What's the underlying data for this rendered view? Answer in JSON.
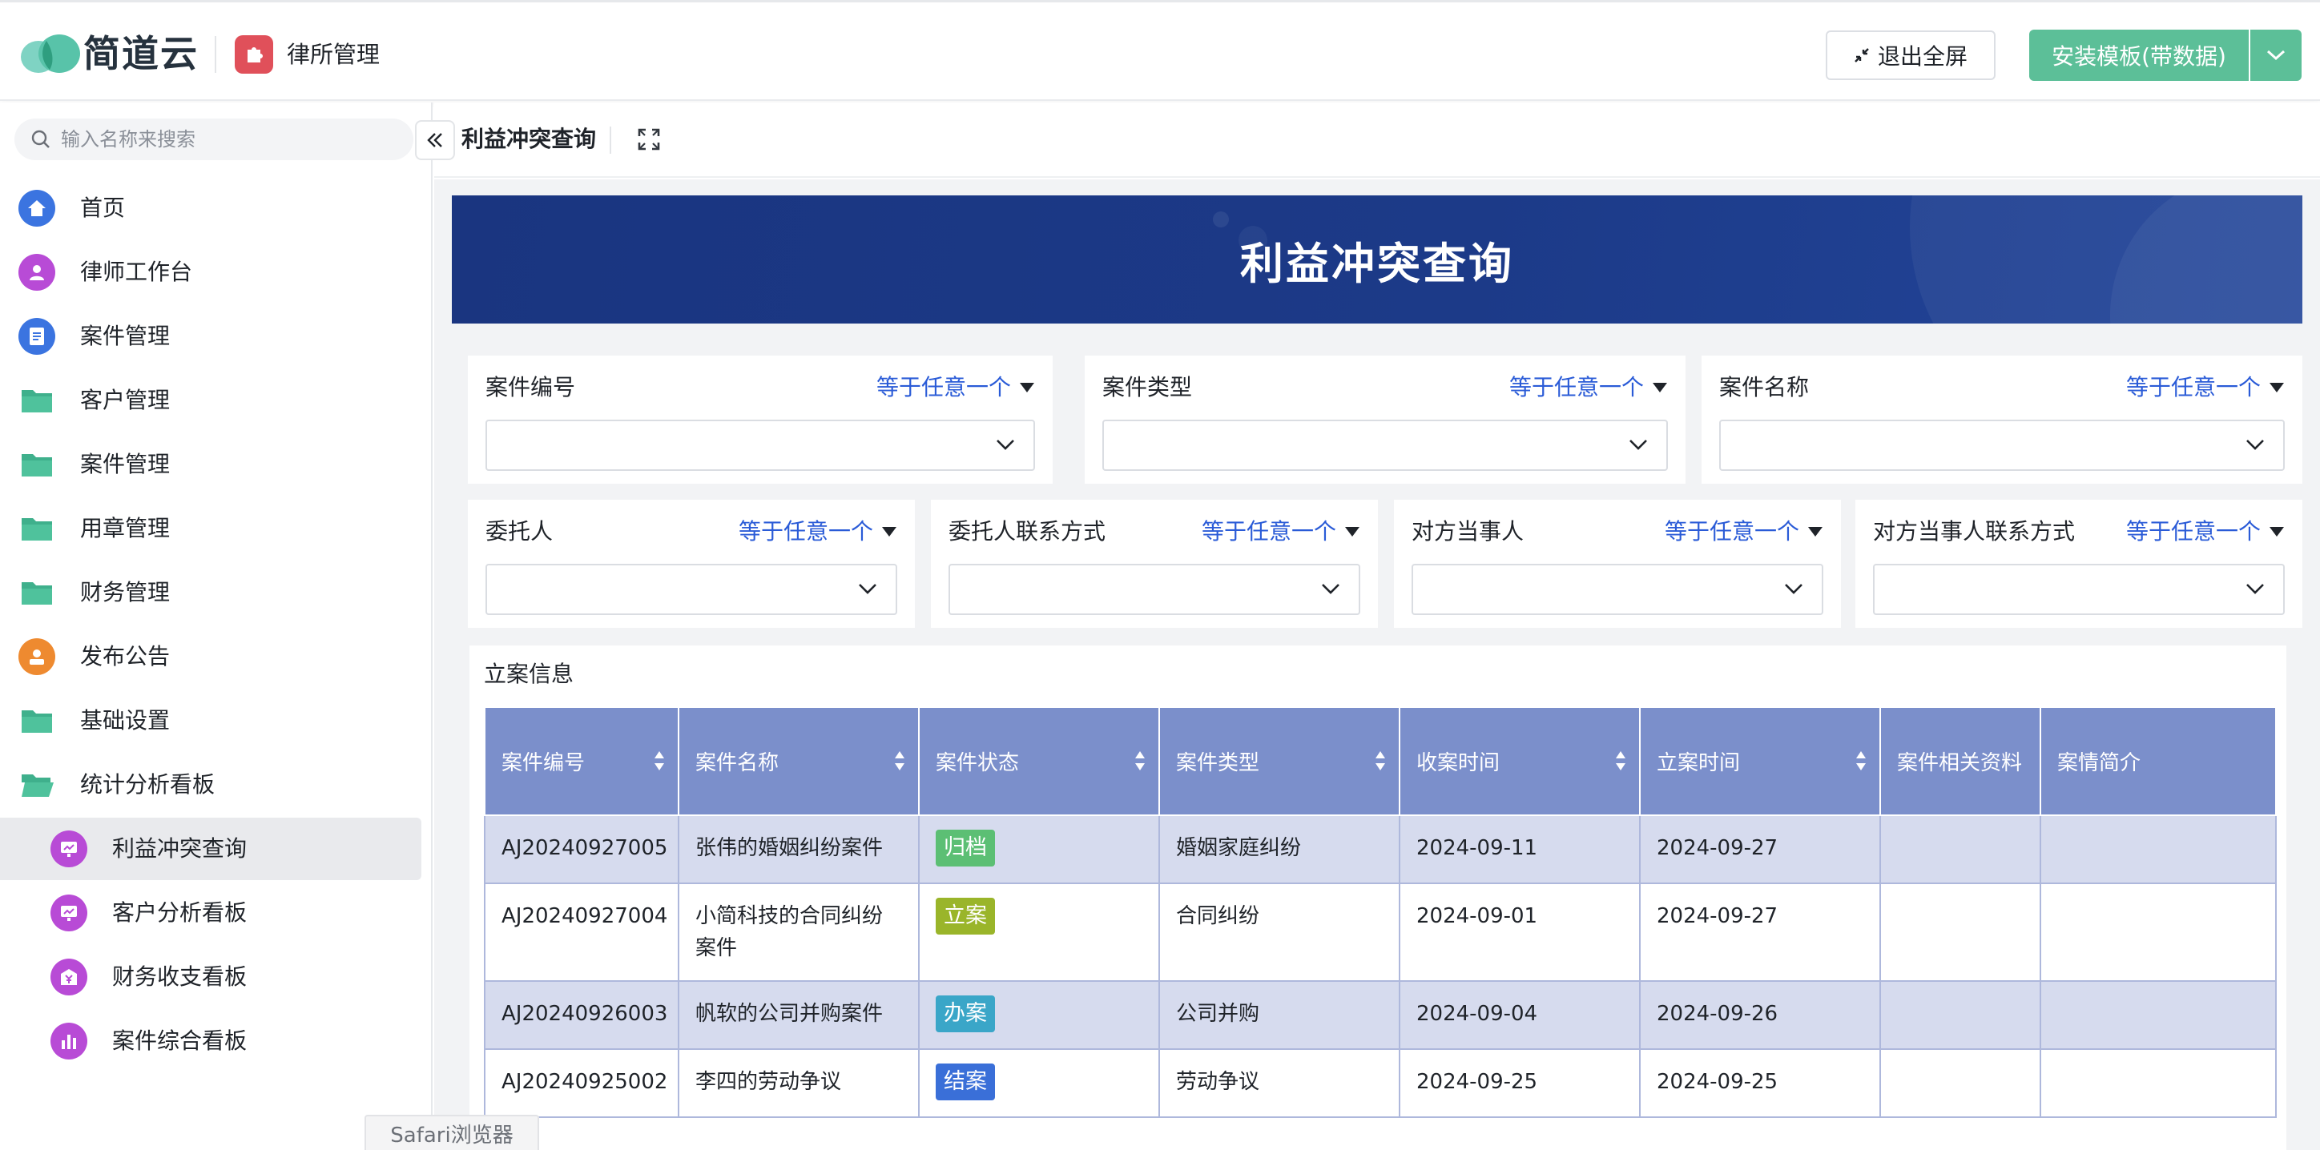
{
  "header": {
    "brand_name": "简道云",
    "app_name": "律所管理",
    "exit_fullscreen": "退出全屏",
    "install_template": "安装模板(带数据)"
  },
  "sidebar": {
    "search_placeholder": "输入名称来搜索",
    "items": [
      {
        "label": "首页",
        "icon": "home-icon"
      },
      {
        "label": "律师工作台",
        "icon": "lawyer-icon"
      },
      {
        "label": "案件管理",
        "icon": "document-icon"
      },
      {
        "label": "客户管理",
        "icon": "folder-icon"
      },
      {
        "label": "案件管理",
        "icon": "folder-icon"
      },
      {
        "label": "用章管理",
        "icon": "folder-icon"
      },
      {
        "label": "财务管理",
        "icon": "folder-icon"
      },
      {
        "label": "发布公告",
        "icon": "announcement-icon"
      },
      {
        "label": "基础设置",
        "icon": "folder-icon"
      },
      {
        "label": "统计分析看板",
        "icon": "folder-open-icon"
      }
    ],
    "sub_items": [
      {
        "label": "利益冲突查询",
        "icon": "dashboard-icon",
        "active": true
      },
      {
        "label": "客户分析看板",
        "icon": "dashboard-icon"
      },
      {
        "label": "财务收支看板",
        "icon": "finance-icon"
      },
      {
        "label": "案件综合看板",
        "icon": "bar-chart-icon"
      }
    ]
  },
  "page": {
    "title": "利益冲突查询",
    "banner_title": "利益冲突查询"
  },
  "filters": [
    {
      "label": "案件编号",
      "op": "等于任意一个"
    },
    {
      "label": "案件类型",
      "op": "等于任意一个"
    },
    {
      "label": "案件名称",
      "op": "等于任意一个"
    },
    {
      "label": "委托人",
      "op": "等于任意一个"
    },
    {
      "label": "委托人联系方式",
      "op": "等于任意一个"
    },
    {
      "label": "对方当事人",
      "op": "等于任意一个"
    },
    {
      "label": "对方当事人联系方式",
      "op": "等于任意一个"
    }
  ],
  "table": {
    "section_label": "立案信息",
    "columns": [
      "案件编号",
      "案件名称",
      "案件状态",
      "案件类型",
      "收案时间",
      "立案时间",
      "案件相关资料",
      "案情简介"
    ],
    "rows": [
      {
        "id": "AJ20240927005",
        "name": "张伟的婚姻纠纷案件",
        "status": "归档",
        "type": "婚姻家庭纠纷",
        "received": "2024-09-11",
        "filed": "2024-09-27",
        "docs": "",
        "summary": ""
      },
      {
        "id": "AJ20240927004",
        "name": "小简科技的合同纠纷案件",
        "status": "立案",
        "type": "合同纠纷",
        "received": "2024-09-01",
        "filed": "2024-09-27",
        "docs": "",
        "summary": ""
      },
      {
        "id": "AJ20240926003",
        "name": "帆软的公司并购案件",
        "status": "办案",
        "type": "公司并购",
        "received": "2024-09-04",
        "filed": "2024-09-26",
        "docs": "",
        "summary": ""
      },
      {
        "id": "AJ20240925002",
        "name": "李四的劳动争议",
        "status": "结案",
        "type": "劳动争议",
        "received": "2024-09-25",
        "filed": "2024-09-25",
        "docs": "",
        "summary": ""
      }
    ]
  },
  "status_colors": {
    "归档": "#5cbf74",
    "立案": "#9ab52a",
    "办案": "#3aa6c8",
    "结案": "#3a6fd8"
  },
  "colors": {
    "brand_green": "#5cbf98",
    "banner_blue": "#1c3a88",
    "table_header": "#7b8fcb",
    "link_blue": "#2a5bd7"
  },
  "tooltip": "Safari浏览器"
}
